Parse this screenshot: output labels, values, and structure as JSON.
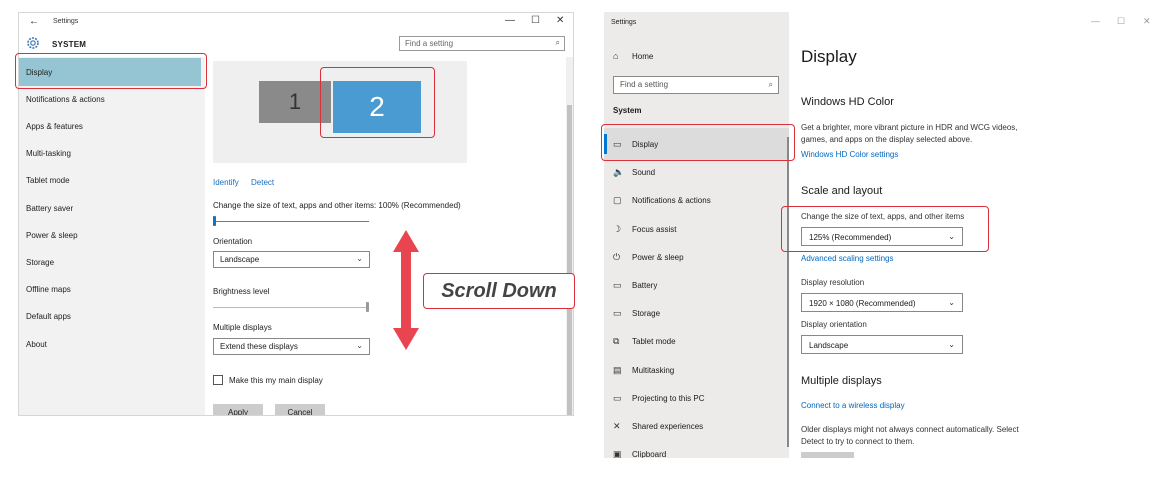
{
  "left_window": {
    "title": "Settings",
    "back_glyph": "←",
    "section": "SYSTEM",
    "search_placeholder": "Find a setting",
    "controls": {
      "minimize": "—",
      "maximize": "☐",
      "close": "✕"
    },
    "nav": [
      "Display",
      "Notifications & actions",
      "Apps & features",
      "Multi-tasking",
      "Tablet mode",
      "Battery saver",
      "Power & sleep",
      "Storage",
      "Offline maps",
      "Default apps",
      "About"
    ],
    "selected_nav": "Display",
    "monitors": [
      "1",
      "2"
    ],
    "identify": "Identify",
    "detect": "Detect",
    "scale_label": "Change the size of text, apps and other items: 100% (Recommended)",
    "scale_value_fraction": 0.0,
    "orientation_label": "Orientation",
    "orientation_value": "Landscape",
    "brightness_label": "Brightness level",
    "brightness_fraction": 1.0,
    "multiple_displays_label": "Multiple displays",
    "multiple_displays_value": "Extend these displays",
    "main_display_checkbox": "Make this my main display",
    "apply": "Apply",
    "cancel": "Cancel"
  },
  "annotation": {
    "scroll_text": "Scroll Down",
    "accent_color": "#d9303a"
  },
  "right_window": {
    "title": "Settings",
    "controls": {
      "minimize": "—",
      "maximize": "☐",
      "close": "✕"
    },
    "home": "Home",
    "search_placeholder": "Find a setting",
    "group": "System",
    "nav": [
      {
        "icon": "display-icon",
        "glyph": "▭",
        "label": "Display"
      },
      {
        "icon": "sound-icon",
        "glyph": "🔈",
        "label": "Sound"
      },
      {
        "icon": "notifications-icon",
        "glyph": "▢",
        "label": "Notifications & actions"
      },
      {
        "icon": "focus-assist-icon",
        "glyph": "☽",
        "label": "Focus assist"
      },
      {
        "icon": "power-icon",
        "glyph": "⏻",
        "label": "Power & sleep"
      },
      {
        "icon": "battery-icon",
        "glyph": "▭",
        "label": "Battery"
      },
      {
        "icon": "storage-icon",
        "glyph": "▭",
        "label": "Storage"
      },
      {
        "icon": "tablet-mode-icon",
        "glyph": "⧉",
        "label": "Tablet mode"
      },
      {
        "icon": "multitasking-icon",
        "glyph": "▤",
        "label": "Multitasking"
      },
      {
        "icon": "projecting-icon",
        "glyph": "▭",
        "label": "Projecting to this PC"
      },
      {
        "icon": "shared-experiences-icon",
        "glyph": "✕",
        "label": "Shared experiences"
      },
      {
        "icon": "clipboard-icon",
        "glyph": "▣",
        "label": "Clipboard"
      }
    ],
    "selected_nav": "Display",
    "page_title": "Display",
    "hd_color_heading": "Windows HD Color",
    "hd_color_text_1": "Get a brighter, more vibrant picture in HDR and WCG videos,",
    "hd_color_text_2": "games, and apps on the display selected above.",
    "hd_color_link": "Windows HD Color settings",
    "scale_heading": "Scale and layout",
    "scale_label": "Change the size of text, apps, and other items",
    "scale_value": "125% (Recommended)",
    "advanced_scaling_link": "Advanced scaling settings",
    "resolution_label": "Display resolution",
    "resolution_value": "1920 × 1080 (Recommended)",
    "orientation_label": "Display orientation",
    "orientation_value": "Landscape",
    "multiple_heading": "Multiple displays",
    "wireless_link": "Connect to a wireless display",
    "multiple_text_1": "Older displays might not always connect automatically. Select",
    "multiple_text_2": "Detect to try to connect to them."
  }
}
